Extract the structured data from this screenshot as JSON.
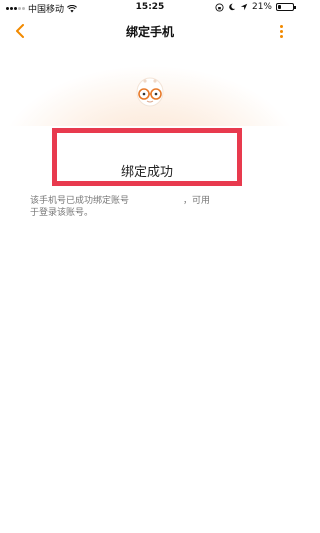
{
  "status_bar": {
    "carrier": "中国移动",
    "time": "15:25",
    "battery_percent": "21%",
    "battery_level": 0.21
  },
  "nav": {
    "back_icon": "chevron-left-icon",
    "title": "绑定手机",
    "more_icon": "more-vertical-icon",
    "accent_color": "#f28a00"
  },
  "result": {
    "title": "绑定成功",
    "description_line1_start": "该手机号已成功绑定账号",
    "description_line1_end": "，可用",
    "description_line2": "于登录该账号。"
  },
  "colors": {
    "highlight_border": "#e83a4e"
  }
}
